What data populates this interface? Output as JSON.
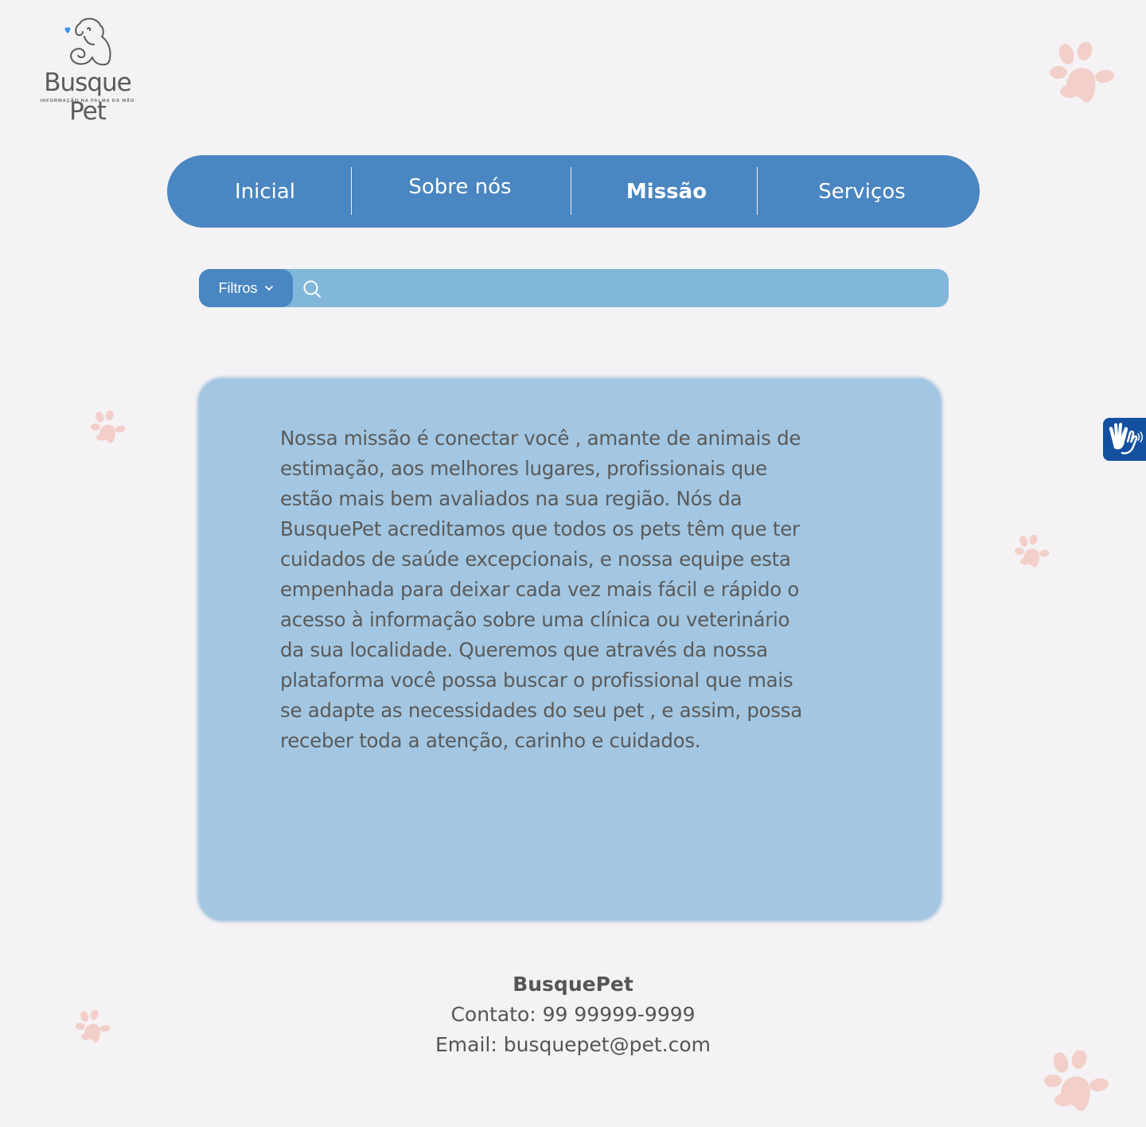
{
  "brand": {
    "name": "Busque Pet",
    "tagline": "INFORMAÇÃO NA PALMA DA MÃO"
  },
  "nav": {
    "items": [
      {
        "label": "Inicial"
      },
      {
        "label": "Sobre nós"
      },
      {
        "label": "Missão",
        "active": true
      },
      {
        "label": "Serviços"
      }
    ]
  },
  "search": {
    "filter_label": "Filtros",
    "value": "",
    "icon": "search-icon"
  },
  "mission": {
    "lines": [
      "Nossa missão é conectar você , amante de animais de",
      "estimação, aos melhores lugares, profissionais que",
      "estão mais bem avaliados na sua região. Nós da",
      "BusquePet acreditamos que todos os pets têm que ter",
      "cuidados de saúde excepcionais, e nossa equipe esta",
      "empenhada para deixar cada vez mais fácil e rápido o",
      "acesso à informação sobre uma clínica ou veterinário",
      "da sua localidade. Queremos que através da nossa",
      "plataforma você possa buscar o profissional que mais",
      "se adapte as necessidades do seu pet , e assim, possa",
      "receber toda a atenção, carinho e cuidados."
    ]
  },
  "footer": {
    "brand": "BusquePet",
    "contact": "Contato: 99 99999-9999",
    "email": "Email: busquepet@pet.com"
  },
  "colors": {
    "background": "#f4f2f4",
    "nav": "#4a86c1",
    "search_bar": "#80b7da",
    "card": "#a3c7e2",
    "paw": "#f3cfc9",
    "accessibility": "#1450a0"
  },
  "widgets": {
    "accessibility_icon": "sign-language-icon"
  }
}
